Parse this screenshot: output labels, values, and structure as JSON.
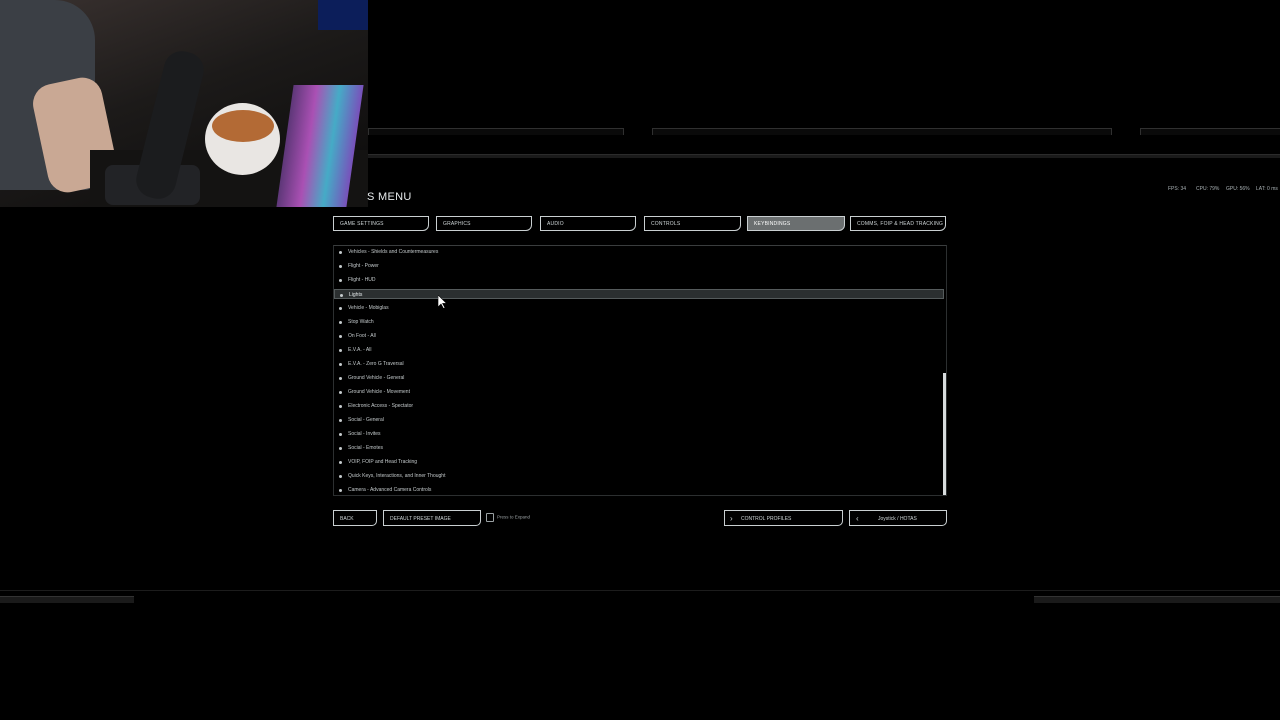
{
  "menu": {
    "title_fragment": "S MENU"
  },
  "perf": {
    "fps": "FPS: 34",
    "cpu": "CPU: 79%",
    "gpu": "GPU: 56%",
    "lat": "LAT: 0 ms"
  },
  "tabs": [
    {
      "label": "GAME SETTINGS",
      "active": false
    },
    {
      "label": "GRAPHICS",
      "active": false
    },
    {
      "label": "AUDIO",
      "active": false
    },
    {
      "label": "CONTROLS",
      "active": false
    },
    {
      "label": "KEYBINDINGS",
      "active": true
    },
    {
      "label": "COMMS, FOIP & HEAD TRACKING",
      "active": false
    }
  ],
  "categories": [
    "Vehicles - Shields and Countermeasures",
    "Flight - Power",
    "Flight - HUD",
    "Lights",
    "Vehicle - Mobiglas",
    "Stop Watch",
    "On Foot - All",
    "E.V.A. - All",
    "E.V.A. - Zero G Traversal",
    "Ground Vehicle - General",
    "Ground Vehicle - Movement",
    "Electronic Access - Spectator",
    "Social - General",
    "Social - Invites",
    "Social - Emotes",
    "VOIP, FOIP and Head Tracking",
    "Quick Keys, Interactions, and Inner Thought",
    "Camera - Advanced Camera Controls"
  ],
  "highlighted_index": 3,
  "buttons": {
    "back": "BACK",
    "default_preset": "DEFAULT PRESET IMAGE",
    "hint": "Press to Expand",
    "control_profiles": "CONTROL PROFILES",
    "joystick": "Joystick / HOTAS"
  }
}
